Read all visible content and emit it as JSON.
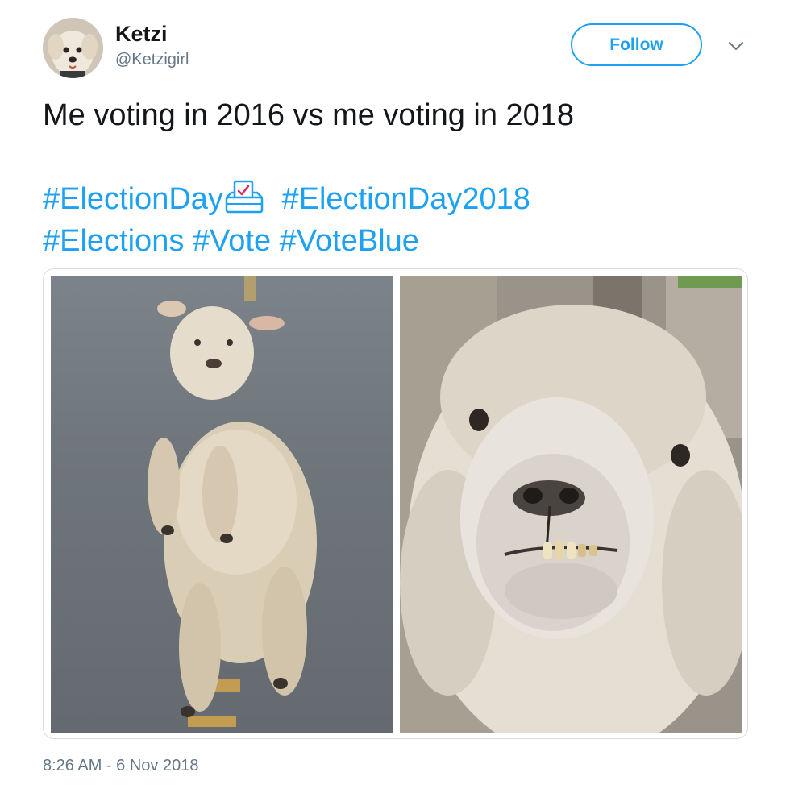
{
  "author": {
    "display_name": "Ketzi",
    "handle": "@Ketzigirl",
    "avatar_icon": "dog-avatar"
  },
  "actions": {
    "follow_label": "Follow",
    "menu_icon": "chevron-down-icon"
  },
  "tweet": {
    "line1": "Me voting in 2016 vs me voting in 2018",
    "hashtags": [
      "#ElectionDay",
      "#ElectionDay2018",
      "#Elections",
      "#Vote",
      "#VoteBlue"
    ],
    "emoji_icon": "ballot-box-icon"
  },
  "media": {
    "photos": [
      {
        "subject": "leaping-lamb-photo"
      },
      {
        "subject": "scruffy-sheep-photo"
      }
    ]
  },
  "timestamp": "8:26 AM - 6 Nov 2018",
  "colors": {
    "link": "#1da1f2",
    "text": "#14171a",
    "secondary": "#657786",
    "border": "#d8dee2"
  }
}
